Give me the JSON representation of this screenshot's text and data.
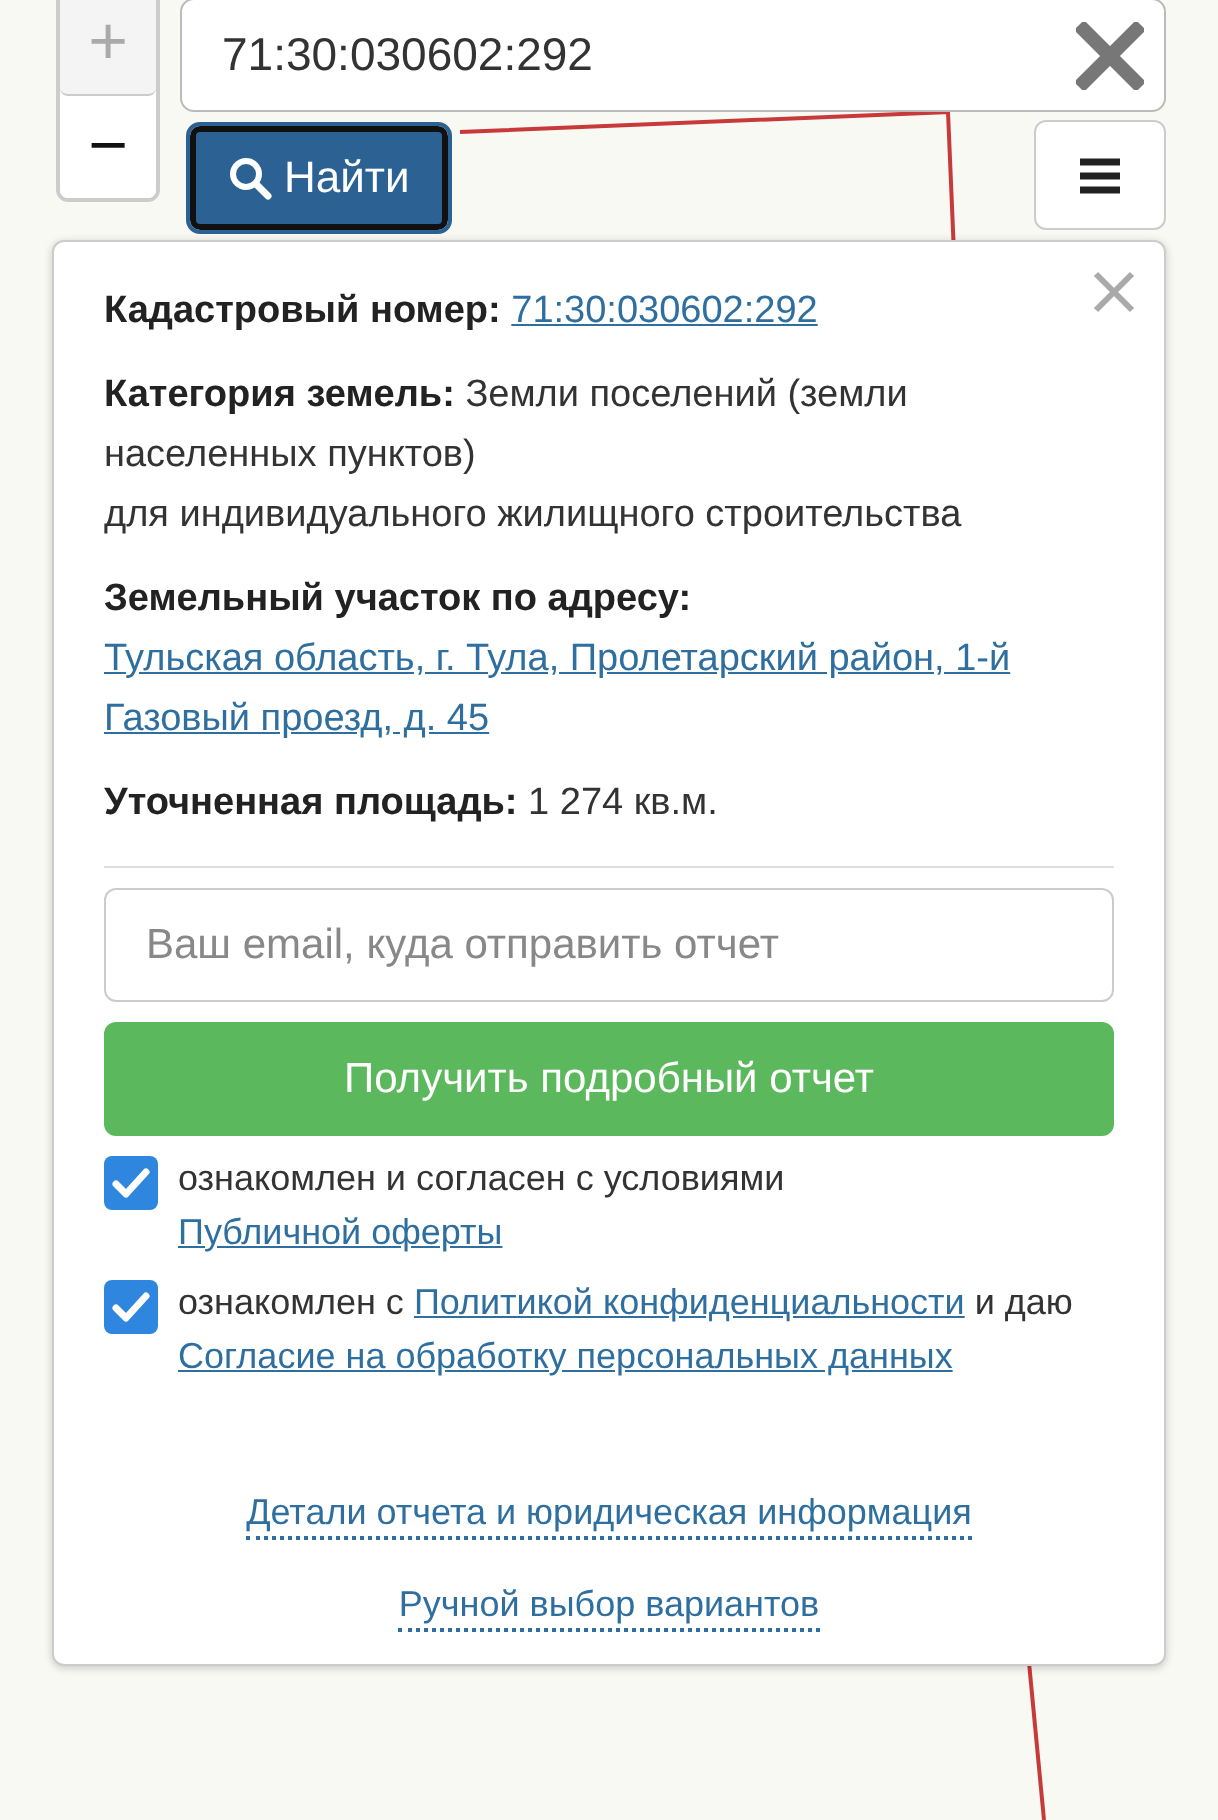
{
  "zoom": {
    "zoom_in": "+",
    "zoom_out": "−"
  },
  "search": {
    "value": "71:30:030602:292"
  },
  "find_button": {
    "label": "Найти"
  },
  "info_panel": {
    "fields": [
      {
        "label": "Кадастровый номер:",
        "kind": "link",
        "value": "71:30:030602:292"
      },
      {
        "label": "Категория земель:",
        "kind": "text",
        "value": "Земли поселений (земли населенных пунктов)",
        "extra": "для индивидуального жилищного строительства"
      },
      {
        "label": "Земельный участок по адресу:",
        "kind": "link",
        "value": "Тульская область, г. Тула, Пролетарский район, 1-й Газовый проезд, д. 45"
      },
      {
        "label": "Уточненная площадь:",
        "kind": "text",
        "value": "1 274 кв.м."
      }
    ],
    "email": {
      "placeholder": "Ваш email, куда отправить отчет"
    },
    "submit": "Получить подробный отчет",
    "consents": [
      {
        "checked": true,
        "parts": [
          {
            "kind": "text",
            "text": "ознакомлен и согласен с условиями "
          },
          {
            "kind": "link",
            "text": "Публичной оферты"
          }
        ]
      },
      {
        "checked": true,
        "parts": [
          {
            "kind": "text",
            "text": "ознакомлен с "
          },
          {
            "kind": "link",
            "text": "Политикой конфиденциальности"
          },
          {
            "kind": "text",
            "text": " и даю "
          },
          {
            "kind": "link",
            "text": "Согласие на обработку персональных данных"
          }
        ]
      }
    ],
    "footer_links": [
      "Детали отчета и юридическая информация",
      "Ручной выбор вариантов"
    ]
  }
}
